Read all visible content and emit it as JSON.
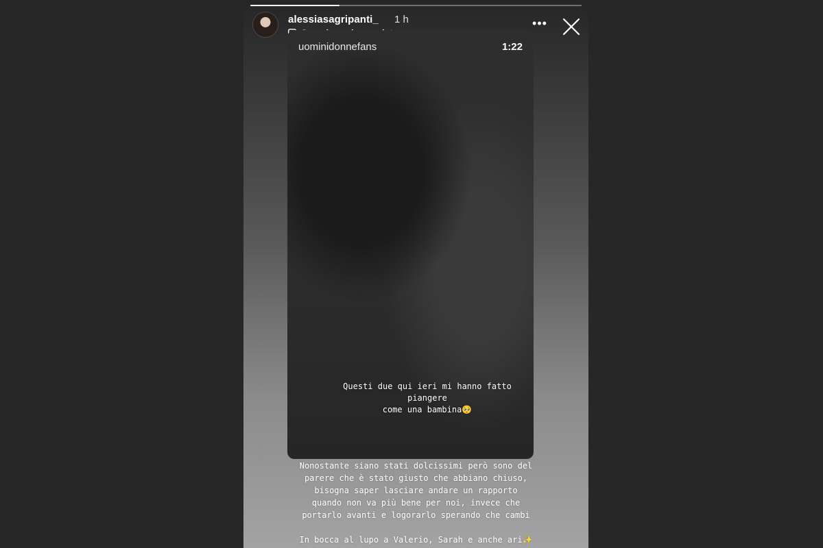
{
  "story": {
    "progress": 0.27,
    "username": "alessiasagripanti_",
    "time_ago": "1 h",
    "reel_link_label": "Guarda reel completo",
    "reel_link_chevron": "›",
    "more_label": "•••",
    "close_icon": "close-icon"
  },
  "reel": {
    "author": "uominidonnefans",
    "duration": "1:22",
    "caption_lines": [
      "Questi due qui ieri mi hanno fatto piangere",
      "come una bambina🥺"
    ]
  },
  "message": {
    "lines": [
      "Nonostante siano stati dolcissimi però sono del",
      "parere che è stato giusto che abbiano chiuso,",
      "bisogna saper lasciare andare un rapporto",
      "quando non va più bene per noi, invece che",
      "portarlo avanti e logorarlo sperando che cambi",
      "In bocca al lupo a Valerio, Sarah e anche ari✨"
    ]
  }
}
